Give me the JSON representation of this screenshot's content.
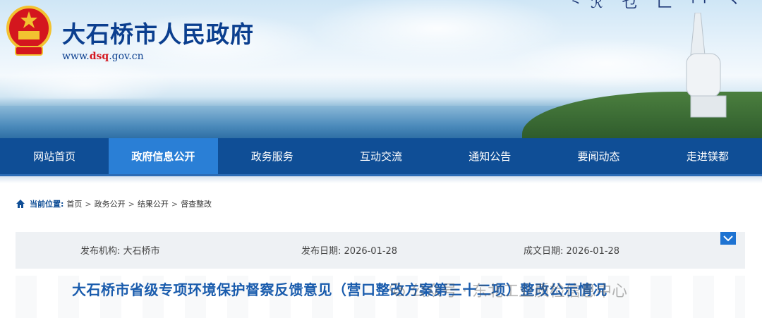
{
  "site": {
    "title": "大石桥市人民政府",
    "url_prefix": "www.",
    "url_highlight": "dsq",
    "url_suffix": ".gov.cn",
    "slogan": "⺀ℛ 乜 𠃊 冖 ⼂"
  },
  "nav": {
    "items": [
      {
        "label": "网站首页",
        "active": false
      },
      {
        "label": "政府信息公开",
        "active": true
      },
      {
        "label": "政务服务",
        "active": false
      },
      {
        "label": "互动交流",
        "active": false
      },
      {
        "label": "通知公告",
        "active": false
      },
      {
        "label": "要闻动态",
        "active": false
      },
      {
        "label": "走进镁都",
        "active": false
      }
    ]
  },
  "breadcrumb": {
    "label": "当前位置:",
    "items": [
      "首页",
      "政务公开",
      "结果公开",
      "督查整改"
    ],
    "separator": ">"
  },
  "meta": {
    "publisher_label": "发布机构:",
    "publisher_value": "大石桥市",
    "publish_date_label": "发布日期:",
    "publish_date_value": "2026-01-28",
    "written_date_label": "成文日期:",
    "written_date_value": "2026-01-28"
  },
  "article": {
    "title": "大石桥市省级专项环境保护督察反馈意见（营口整改方案第三十二项）整改公示情况",
    "watermark": "公众号 · 东北工业质检信息中心"
  },
  "colors": {
    "nav_bg": "#0f4e96",
    "nav_active": "#2a7fd6",
    "title_blue": "#0b3f8f",
    "accent_red": "#d4161e"
  },
  "icons": {
    "emblem": "national-emblem-icon",
    "home": "home-icon",
    "collapse": "chevron-down-icon",
    "watermark": "wechat-icon"
  }
}
